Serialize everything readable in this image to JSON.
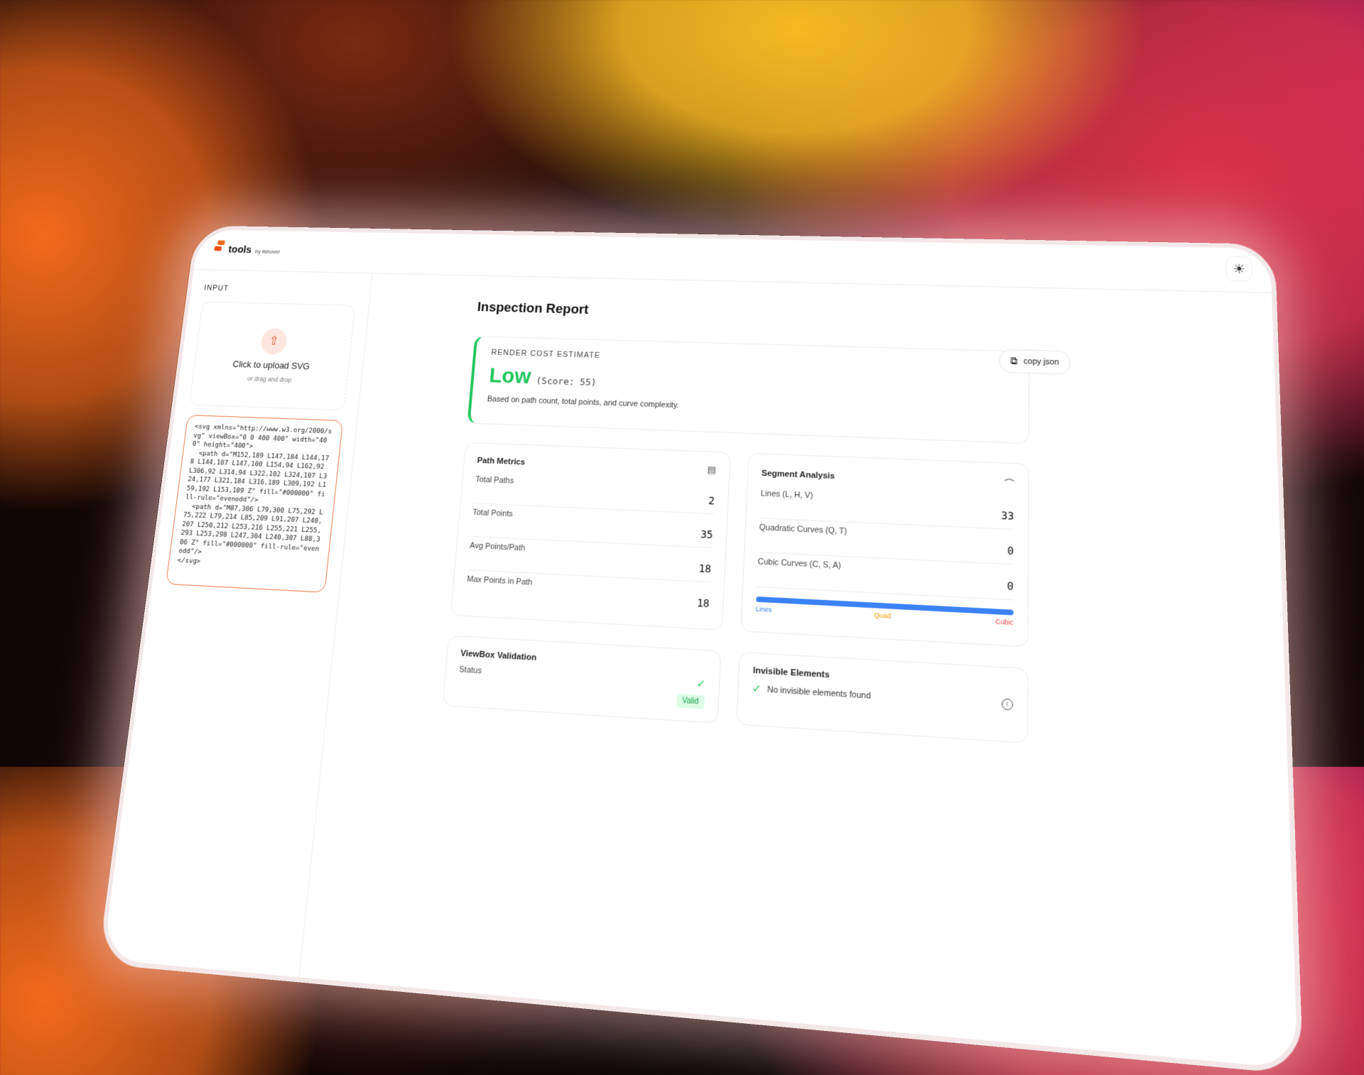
{
  "app": {
    "brand": "tools",
    "brand_sub": "by ilshover"
  },
  "header": {
    "theme_icon": "sun-icon",
    "theme_glyph": "☀"
  },
  "sidebar": {
    "input_label": "INPUT",
    "upload": {
      "title": "Click to upload SVG",
      "subtitle": "or drag and drop",
      "icon": "upload-icon",
      "glyph": "⇧"
    },
    "code": "<svg xmlns=\"http://www.w3.org/2000/svg\" viewBox=\"0 0 400 400\" width=\"400\" height=\"400\">\n  <path d=\"M152,189 L147,184 L144,178 L144,107 L147,100 L154,94 L162,92 L306,92 L314,94 L322,102 L324,107 L324,177 L321,184 L316,189 L309,192 L159,192 L153,189 Z\" fill=\"#000000\" fill-rule=\"evenodd\"/>\n  <path d=\"M87,306 L79,300 L75,292 L75,222 L79,214 L85,209 L91,207 L240,207 L250,212 L253,216 L255,221 L255,293 L253,298 L247,304 L240,307 L88,306 Z\" fill=\"#000000\" fill-rule=\"evenodd\"/>\n</svg>"
  },
  "report": {
    "title": "Inspection Report",
    "copy_label": "copy json",
    "copy_icon": "copy-icon",
    "copy_glyph": "⧉",
    "cost": {
      "label": "RENDER COST ESTIMATE",
      "level": "Low",
      "score": "(Score: 55)",
      "description": "Based on path count, total points, and curve complexity.",
      "color": "#22c55e"
    },
    "path_metrics": {
      "title": "Path Metrics",
      "icon": "document-icon",
      "glyph": "▤",
      "items": [
        {
          "label": "Total Paths",
          "value": "2"
        },
        {
          "label": "Total Points",
          "value": "35"
        },
        {
          "label": "Avg Points/Path",
          "value": "18"
        },
        {
          "label": "Max Points in Path",
          "value": "18"
        }
      ]
    },
    "segment_analysis": {
      "title": "Segment Analysis",
      "icon": "bezier-curve-icon",
      "glyph": "⌒",
      "items": [
        {
          "label": "Lines (L, H, V)",
          "value": "33"
        },
        {
          "label": "Quadratic Curves (Q, T)",
          "value": "0"
        },
        {
          "label": "Cubic Curves (C, S, A)",
          "value": "0"
        }
      ],
      "legend": {
        "lines": "Lines",
        "quad": "Quad",
        "cubic": "Cubic"
      },
      "colors": {
        "lines": "#3b82f6",
        "quad": "#f59e0b",
        "cubic": "#ef4444"
      }
    },
    "viewbox": {
      "title": "ViewBox Validation",
      "status_label": "Status",
      "status_value": "Valid",
      "check_icon": "checkmark-icon",
      "glyph": "✓"
    },
    "invisible": {
      "title": "Invisible Elements",
      "message": "No invisible elements found",
      "check_glyph": "✓",
      "info_icon": "info-icon",
      "info_glyph": "i"
    }
  }
}
